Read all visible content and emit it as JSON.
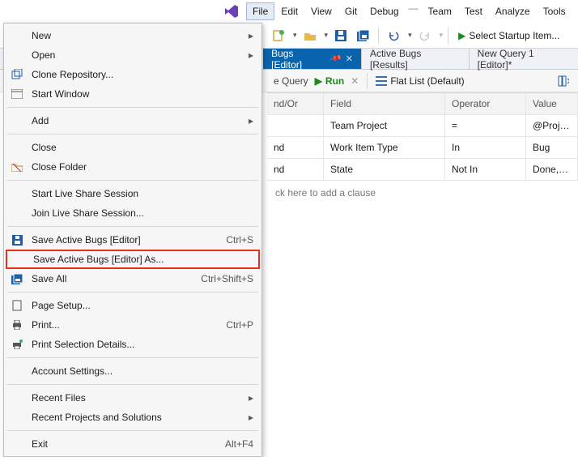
{
  "menubar": {
    "items": [
      "File",
      "Edit",
      "View",
      "Git",
      "Debug",
      "---",
      "Team",
      "Test",
      "Analyze",
      "Tools"
    ]
  },
  "toolbar": {
    "startup_label": "Select Startup Item..."
  },
  "tabs": {
    "active": "Bugs [Editor]",
    "t1": "Active Bugs [Results]",
    "t2": "New Query 1 [Editor]*"
  },
  "querybar": {
    "query_lbl": "e Query",
    "run": "Run",
    "flat": "Flat List (Default)"
  },
  "grid": {
    "headers": [
      "nd/Or",
      "Field",
      "Operator",
      "Value"
    ],
    "rows": [
      [
        "",
        "Team Project",
        "=",
        "@Project"
      ],
      [
        "nd",
        "Work Item Type",
        "In",
        "Bug"
      ],
      [
        "nd",
        "State",
        "Not In",
        "Done, Completed,"
      ]
    ],
    "add_clause": "ck here to add a clause"
  },
  "filemenu": {
    "items": [
      {
        "label": "New",
        "shortcut": "",
        "sub": true,
        "icon": ""
      },
      {
        "label": "Open",
        "shortcut": "",
        "sub": true,
        "icon": ""
      },
      {
        "label": "Clone Repository...",
        "shortcut": "",
        "sub": false,
        "icon": "clone"
      },
      {
        "label": "Start Window",
        "shortcut": "",
        "sub": false,
        "icon": "window"
      },
      {
        "divider": true
      },
      {
        "label": "Add",
        "shortcut": "",
        "sub": true,
        "icon": ""
      },
      {
        "divider": true
      },
      {
        "label": "Close",
        "shortcut": "",
        "sub": false,
        "icon": ""
      },
      {
        "label": "Close Folder",
        "shortcut": "",
        "sub": false,
        "icon": "closefolder"
      },
      {
        "divider": true
      },
      {
        "label": "Start Live Share Session",
        "shortcut": "",
        "sub": false,
        "icon": ""
      },
      {
        "label": "Join Live Share Session...",
        "shortcut": "",
        "sub": false,
        "icon": ""
      },
      {
        "divider": true
      },
      {
        "label": "Save Active Bugs [Editor]",
        "shortcut": "Ctrl+S",
        "sub": false,
        "icon": "save"
      },
      {
        "label": "Save Active Bugs [Editor] As...",
        "shortcut": "",
        "sub": false,
        "icon": "",
        "hl": true
      },
      {
        "label": "Save All",
        "shortcut": "Ctrl+Shift+S",
        "sub": false,
        "icon": "saveall"
      },
      {
        "divider": true
      },
      {
        "label": "Page Setup...",
        "shortcut": "",
        "sub": false,
        "icon": "page"
      },
      {
        "label": "Print...",
        "shortcut": "Ctrl+P",
        "sub": false,
        "icon": "print"
      },
      {
        "label": "Print Selection Details...",
        "shortcut": "",
        "sub": false,
        "icon": "printsel"
      },
      {
        "divider": true
      },
      {
        "label": "Account Settings...",
        "shortcut": "",
        "sub": false,
        "icon": ""
      },
      {
        "divider": true
      },
      {
        "label": "Recent Files",
        "shortcut": "",
        "sub": true,
        "icon": ""
      },
      {
        "label": "Recent Projects and Solutions",
        "shortcut": "",
        "sub": true,
        "icon": ""
      },
      {
        "divider": true
      },
      {
        "label": "Exit",
        "shortcut": "Alt+F4",
        "sub": false,
        "icon": ""
      }
    ]
  }
}
